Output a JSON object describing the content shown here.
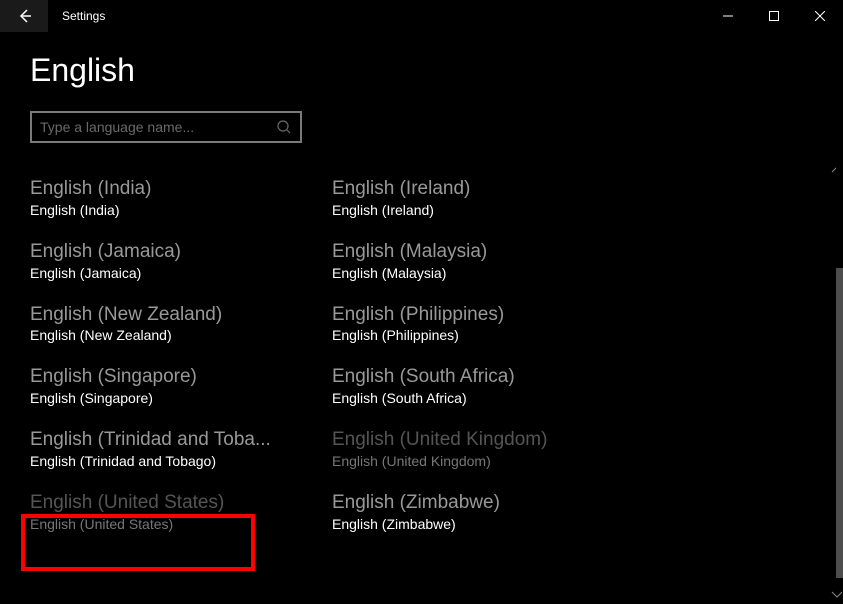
{
  "window": {
    "title": "Settings"
  },
  "page": {
    "title": "English"
  },
  "search": {
    "placeholder": "Type a language name..."
  },
  "languages": [
    {
      "title": "English (India)",
      "sub": "English (India)",
      "dimmed": false
    },
    {
      "title": "English (Ireland)",
      "sub": "English (Ireland)",
      "dimmed": false
    },
    {
      "title": "English (Jamaica)",
      "sub": "English (Jamaica)",
      "dimmed": false
    },
    {
      "title": "English (Malaysia)",
      "sub": "English (Malaysia)",
      "dimmed": false
    },
    {
      "title": "English (New Zealand)",
      "sub": "English (New Zealand)",
      "dimmed": false
    },
    {
      "title": "English (Philippines)",
      "sub": "English (Philippines)",
      "dimmed": false
    },
    {
      "title": "English (Singapore)",
      "sub": "English (Singapore)",
      "dimmed": false
    },
    {
      "title": "English (South Africa)",
      "sub": "English (South Africa)",
      "dimmed": false
    },
    {
      "title": "English (Trinidad and Toba...",
      "sub": "English (Trinidad and Tobago)",
      "dimmed": false
    },
    {
      "title": "English (United Kingdom)",
      "sub": "English (United Kingdom)",
      "dimmed": true
    },
    {
      "title": "English (United States)",
      "sub": "English (United States)",
      "dimmed": true
    },
    {
      "title": "English (Zimbabwe)",
      "sub": "English (Zimbabwe)",
      "dimmed": false
    }
  ]
}
